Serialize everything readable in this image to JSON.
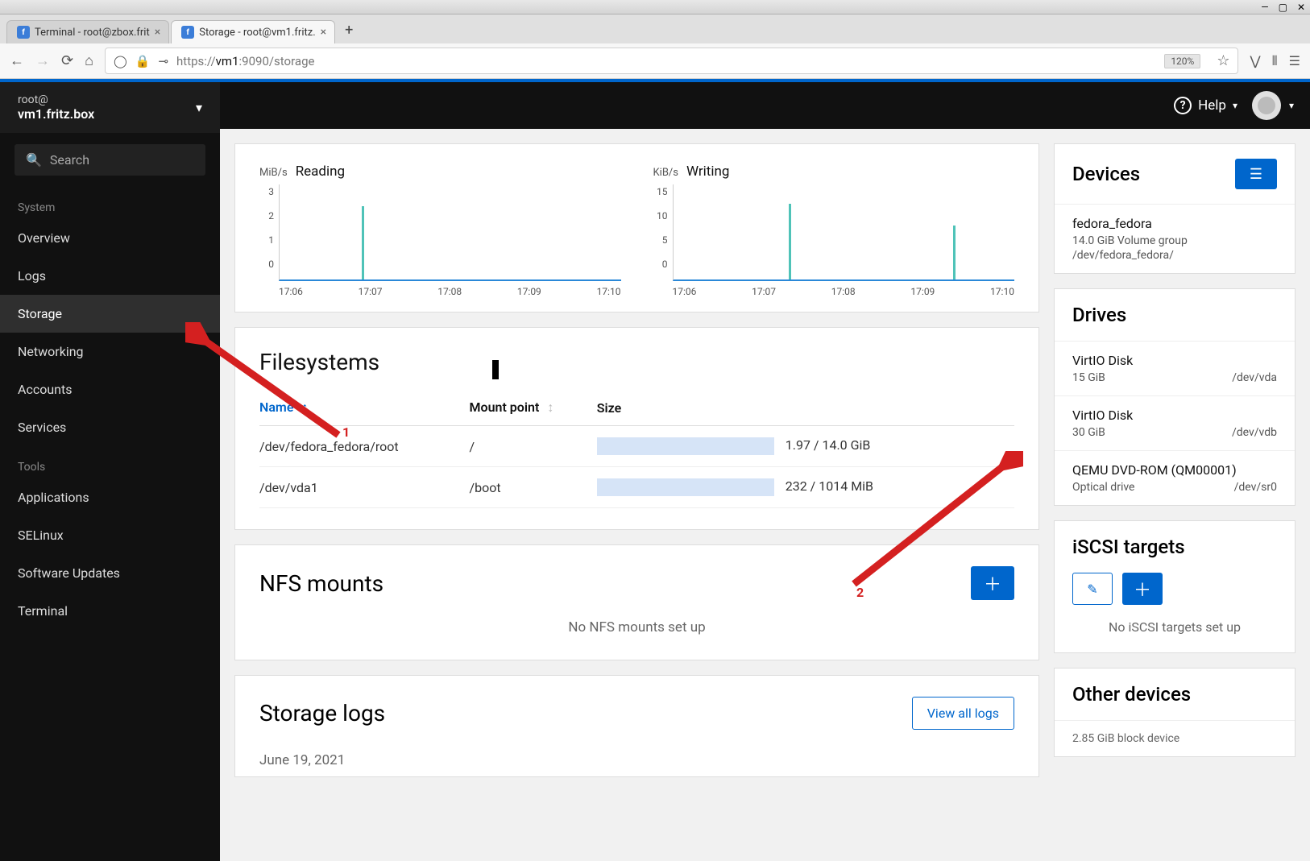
{
  "browser": {
    "tabs": [
      {
        "title": "Terminal - root@zbox.frit",
        "active": false
      },
      {
        "title": "Storage - root@vm1.fritz.",
        "active": true
      }
    ],
    "url_proto": "https://",
    "url_host": "vm1",
    "url_port_path": ":9090/storage",
    "zoom": "120%"
  },
  "header": {
    "help": "Help"
  },
  "sidebar": {
    "host_user": "root@",
    "host_name": "vm1.fritz.box",
    "search_placeholder": "Search",
    "groups": [
      {
        "label": "System",
        "items": [
          "Overview",
          "Logs",
          "Storage",
          "Networking",
          "Accounts",
          "Services"
        ]
      },
      {
        "label": "Tools",
        "items": [
          "Applications",
          "SELinux",
          "Software Updates",
          "Terminal"
        ]
      }
    ],
    "active_item": "Storage"
  },
  "charts": {
    "reading": {
      "unit": "MiB/s",
      "title": "Reading"
    },
    "writing": {
      "unit": "KiB/s",
      "title": "Writing"
    }
  },
  "chart_data": [
    {
      "type": "line",
      "title": "Reading",
      "ylabel": "MiB/s",
      "ylim": [
        0,
        3
      ],
      "x_ticks": [
        "17:06",
        "17:07",
        "17:08",
        "17:09",
        "17:10"
      ],
      "y_ticks": [
        0,
        1,
        2,
        3
      ],
      "spikes": [
        {
          "x": "17:07",
          "value": 2.3
        }
      ]
    },
    {
      "type": "line",
      "title": "Writing",
      "ylabel": "KiB/s",
      "ylim": [
        0,
        15
      ],
      "x_ticks": [
        "17:06",
        "17:07",
        "17:08",
        "17:09",
        "17:10"
      ],
      "y_ticks": [
        0,
        5,
        10,
        15
      ],
      "spikes": [
        {
          "x": "17:07.5",
          "value": 12
        },
        {
          "x": "17:09.7",
          "value": 8.5
        }
      ]
    }
  ],
  "filesystems": {
    "title": "Filesystems",
    "columns": {
      "name": "Name",
      "mount": "Mount point",
      "size": "Size"
    },
    "rows": [
      {
        "name": "/dev/fedora_fedora/root",
        "mount": "/",
        "used_pct": 14,
        "text": "1.97 / 14.0 GiB"
      },
      {
        "name": "/dev/vda1",
        "mount": "/boot",
        "used_pct": 23,
        "text": "232 / 1014 MiB"
      }
    ]
  },
  "nfs": {
    "title": "NFS mounts",
    "empty": "No NFS mounts set up"
  },
  "logs": {
    "title": "Storage logs",
    "view_all": "View all logs",
    "date": "June 19, 2021"
  },
  "devices": {
    "title": "Devices",
    "items": [
      {
        "name": "fedora_fedora",
        "line2": "14.0 GiB Volume group",
        "line3": "/dev/fedora_fedora/"
      }
    ]
  },
  "drives": {
    "title": "Drives",
    "items": [
      {
        "name": "VirtIO Disk",
        "size": "15 GiB",
        "dev": "/dev/vda"
      },
      {
        "name": "VirtIO Disk",
        "size": "30 GiB",
        "dev": "/dev/vdb"
      },
      {
        "name": "QEMU DVD-ROM (QM00001)",
        "size": "Optical drive",
        "dev": "/dev/sr0"
      }
    ]
  },
  "iscsi": {
    "title": "iSCSI targets",
    "empty": "No iSCSI targets set up"
  },
  "other": {
    "title": "Other devices",
    "partial": "2.85 GiB block device"
  },
  "annotations": {
    "a1": "1",
    "a2": "2"
  }
}
